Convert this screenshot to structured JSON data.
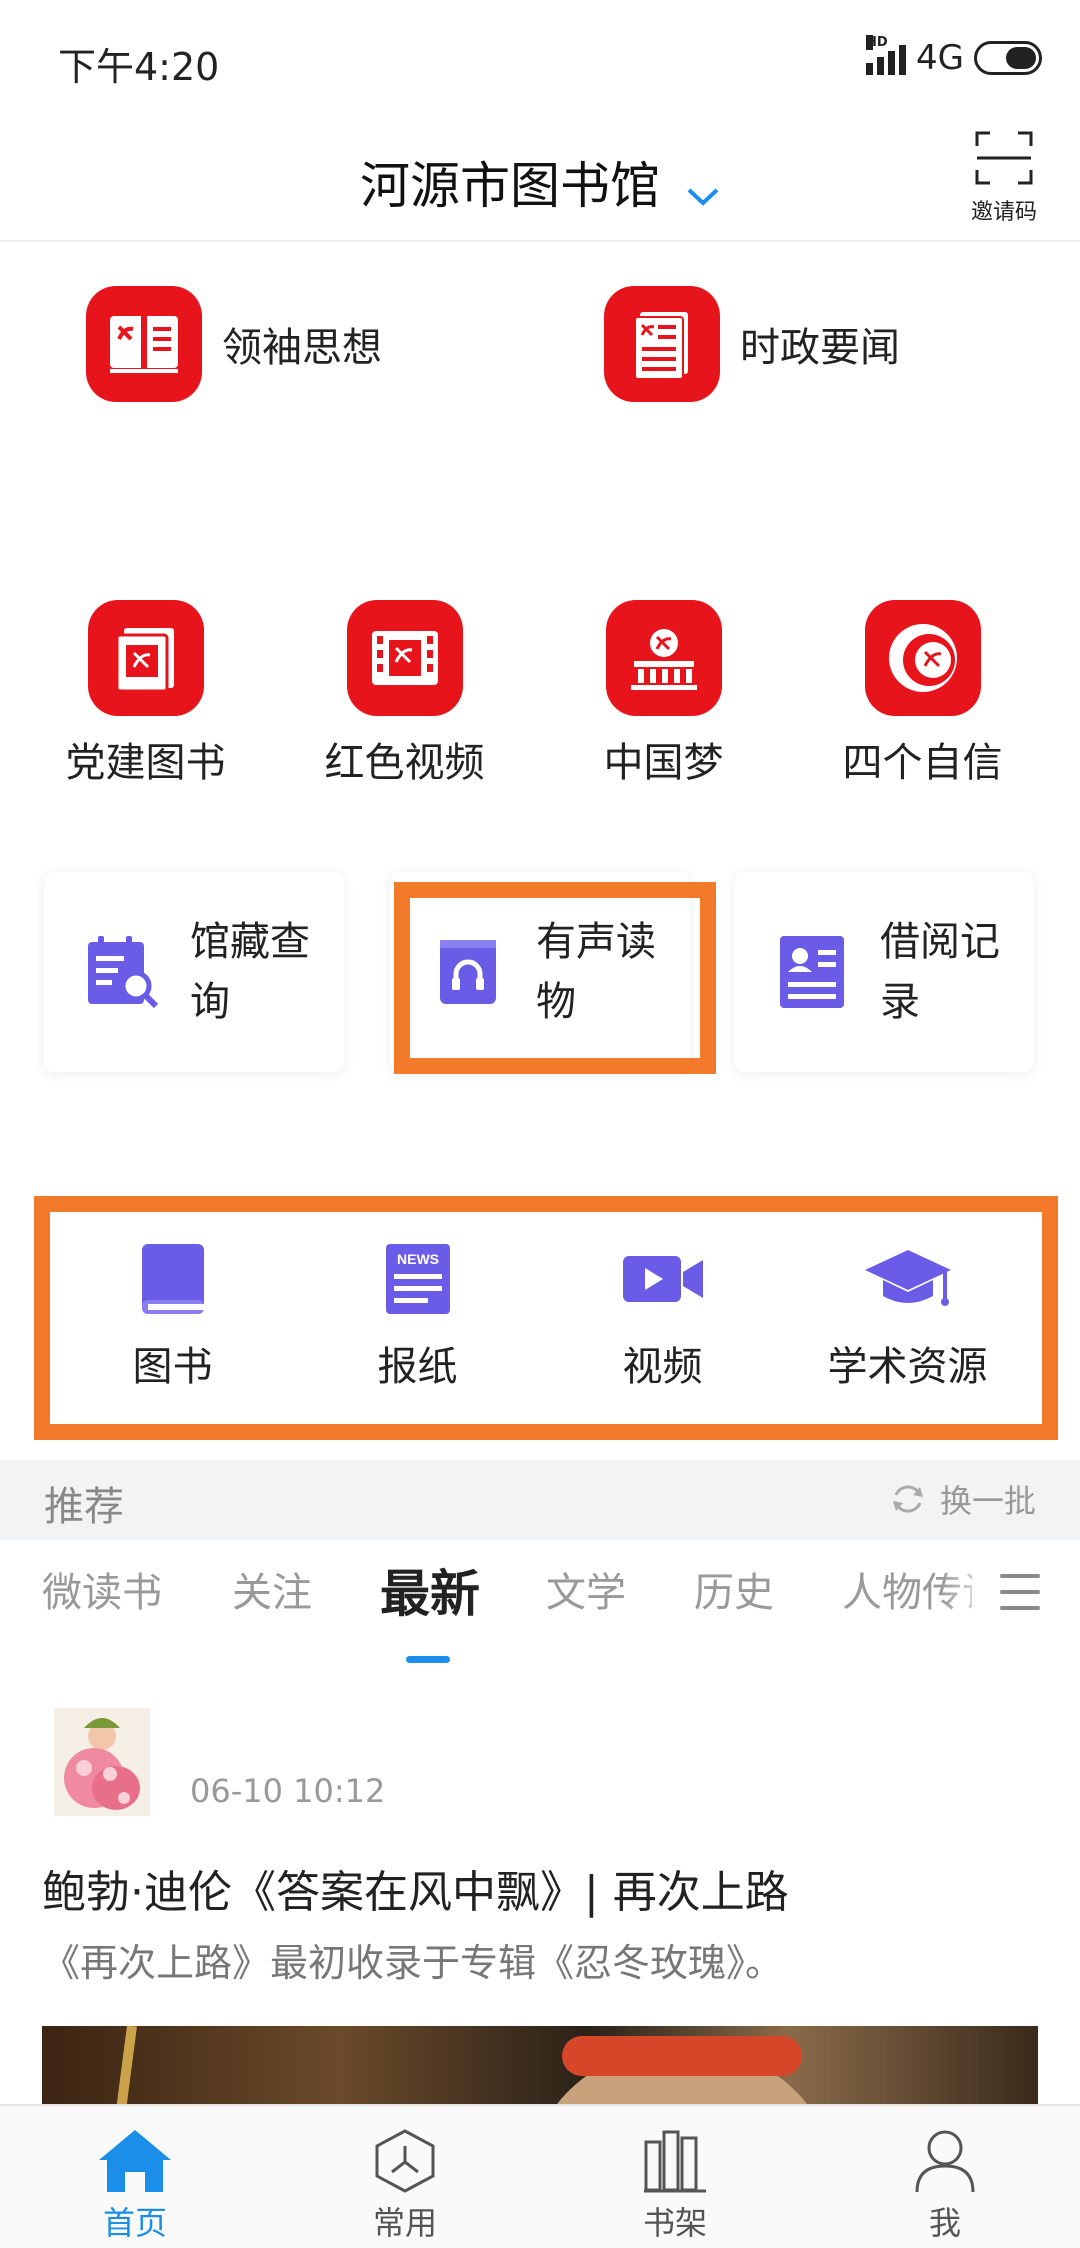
{
  "status_bar": {
    "time": "下午4:20",
    "hd": "HD",
    "network": "4G"
  },
  "header": {
    "library_name": "河源市图书馆",
    "invite_label": "邀请码"
  },
  "top_links": [
    {
      "label": "领袖思想",
      "icon": "leader-thought-icon"
    },
    {
      "label": "时政要闻",
      "icon": "current-affairs-icon"
    }
  ],
  "party_grid": [
    {
      "label": "党建图书",
      "icon": "party-book-icon"
    },
    {
      "label": "红色视频",
      "icon": "red-video-icon"
    },
    {
      "label": "中国梦",
      "icon": "china-dream-icon"
    },
    {
      "label": "四个自信",
      "icon": "four-confidences-icon"
    }
  ],
  "feature_cards": [
    {
      "label": "馆藏查询",
      "icon": "collection-search-icon"
    },
    {
      "label": "有声读物",
      "icon": "audiobook-icon"
    },
    {
      "label": "借阅记录",
      "icon": "borrow-record-icon"
    }
  ],
  "resources": [
    {
      "label": "图书",
      "icon": "book-icon"
    },
    {
      "label": "报纸",
      "icon": "newspaper-icon",
      "badge": "NEWS"
    },
    {
      "label": "视频",
      "icon": "video-icon"
    },
    {
      "label": "学术资源",
      "icon": "academic-cap-icon"
    }
  ],
  "recommend": {
    "title": "推荐",
    "refresh_label": "换一批"
  },
  "tabs": [
    "微读书",
    "关注",
    "最新",
    "文学",
    "历史",
    "人物传记"
  ],
  "active_tab": "最新",
  "article": {
    "time": "06-10 10:12",
    "title": "鲍勃·迪伦《答案在风中飘》| 再次上路",
    "summary": "《再次上路》最初收录于专辑《忍冬玫瑰》。"
  },
  "bottom_nav": [
    {
      "label": "首页",
      "icon": "home-icon",
      "active": true
    },
    {
      "label": "常用",
      "icon": "frequent-icon",
      "active": false
    },
    {
      "label": "书架",
      "icon": "bookshelf-icon",
      "active": false
    },
    {
      "label": "我",
      "icon": "profile-icon",
      "active": false
    }
  ],
  "colors": {
    "accent": "#1a8ee8",
    "party_red": "#e8141b",
    "icon_purple": "#6b5ce7",
    "highlight_orange": "#f47a2b"
  }
}
